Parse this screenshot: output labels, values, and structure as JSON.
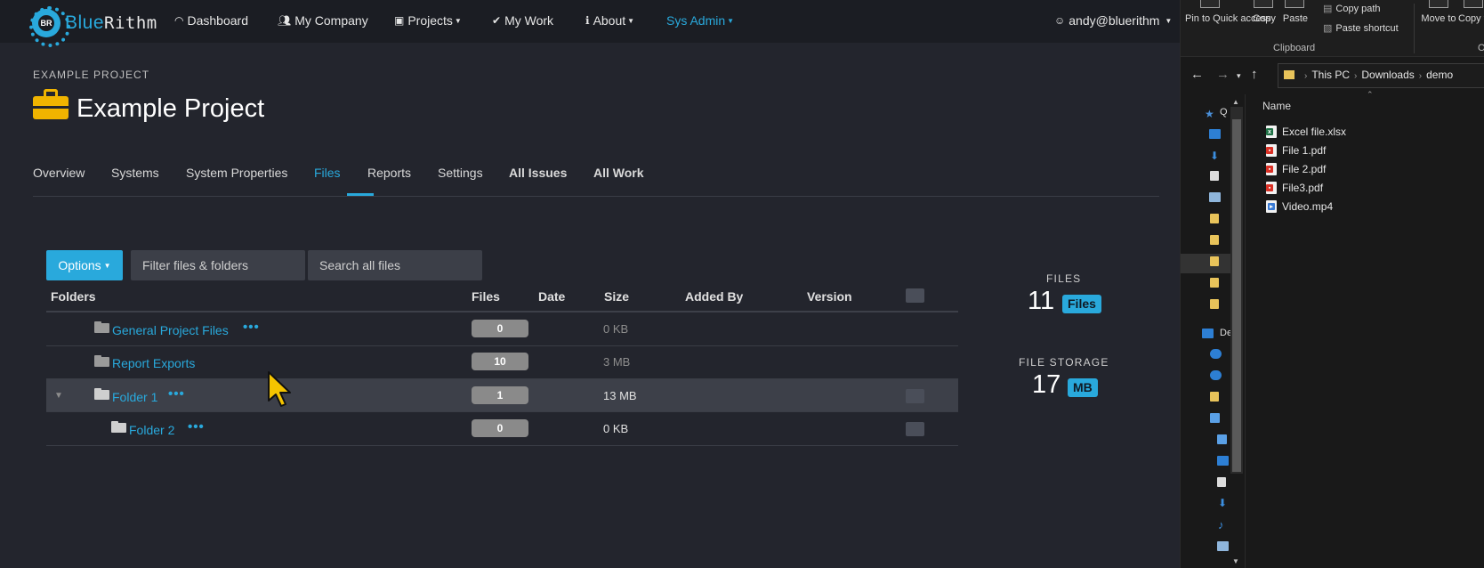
{
  "brand": {
    "name_part1": "Blue",
    "name_part2": "Rithm",
    "logo_initials": "BR",
    "accent": "#29a9dc"
  },
  "nav": {
    "items": [
      {
        "label": "Dashboard",
        "icon": "dashboard-icon"
      },
      {
        "label": "My Company",
        "icon": "users-icon"
      },
      {
        "label": "Projects",
        "icon": "briefcase-icon",
        "dropdown": true
      },
      {
        "label": "My Work",
        "icon": "check-icon"
      },
      {
        "label": "About",
        "icon": "info-icon",
        "dropdown": true
      },
      {
        "label": "Sys Admin",
        "dropdown": true
      }
    ],
    "user": "andy@bluerithm"
  },
  "project": {
    "label": "EXAMPLE PROJECT",
    "title": "Example Project",
    "icon": "briefcase-icon",
    "icon_color": "#f0b400"
  },
  "tabs": [
    {
      "label": "Overview"
    },
    {
      "label": "Systems"
    },
    {
      "label": "System Properties"
    },
    {
      "label": "Files",
      "active": true
    },
    {
      "label": "Reports"
    },
    {
      "label": "Settings"
    },
    {
      "label": "All Issues",
      "bold": true
    },
    {
      "label": "All Work",
      "bold": true
    }
  ],
  "toolbar": {
    "options_label": "Options",
    "filter_placeholder": "Filter files & folders",
    "search_placeholder": "Search all files"
  },
  "table": {
    "headers": [
      "Folders",
      "Files",
      "Date",
      "Size",
      "Added By",
      "Version"
    ],
    "rows": [
      {
        "name": "General Project Files",
        "files": "0",
        "size": "0 KB",
        "menu": "•••",
        "checkbox": false
      },
      {
        "name": "Report Exports",
        "files": "10",
        "size": "3 MB",
        "checkbox": false
      },
      {
        "name": "Folder 1",
        "files": "1",
        "size": "13 MB",
        "menu": "•••",
        "expanded": true,
        "selected": true,
        "checkbox": true
      },
      {
        "name": "Folder 2",
        "files": "0",
        "size": "0 KB",
        "menu": "•••",
        "checkbox": true
      }
    ]
  },
  "stats": {
    "files_label": "FILES",
    "files_value": "11",
    "files_badge": "Files",
    "storage_label": "FILE STORAGE",
    "storage_value": "17",
    "storage_badge": "MB"
  },
  "explorer": {
    "ribbon": {
      "pin_label": "Pin to Quick access",
      "copy_label": "Copy",
      "paste_label": "Paste",
      "copy_path_label": "Copy path",
      "paste_shortcut_label": "Paste shortcut",
      "move_to_label": "Move to",
      "copy_to_label": "Copy to",
      "clipboard_group": "Clipboard",
      "next_group": "O"
    },
    "breadcrumb": [
      "This PC",
      "Downloads",
      "demo"
    ],
    "column_header": "Name",
    "nav_pane_texts": [
      "Q",
      "De"
    ],
    "files": [
      {
        "name": "Excel file.xlsx",
        "type": "excel"
      },
      {
        "name": "File 1.pdf",
        "type": "pdf"
      },
      {
        "name": "File 2.pdf",
        "type": "pdf"
      },
      {
        "name": "File3.pdf",
        "type": "pdf"
      },
      {
        "name": "Video.mp4",
        "type": "video"
      }
    ]
  }
}
